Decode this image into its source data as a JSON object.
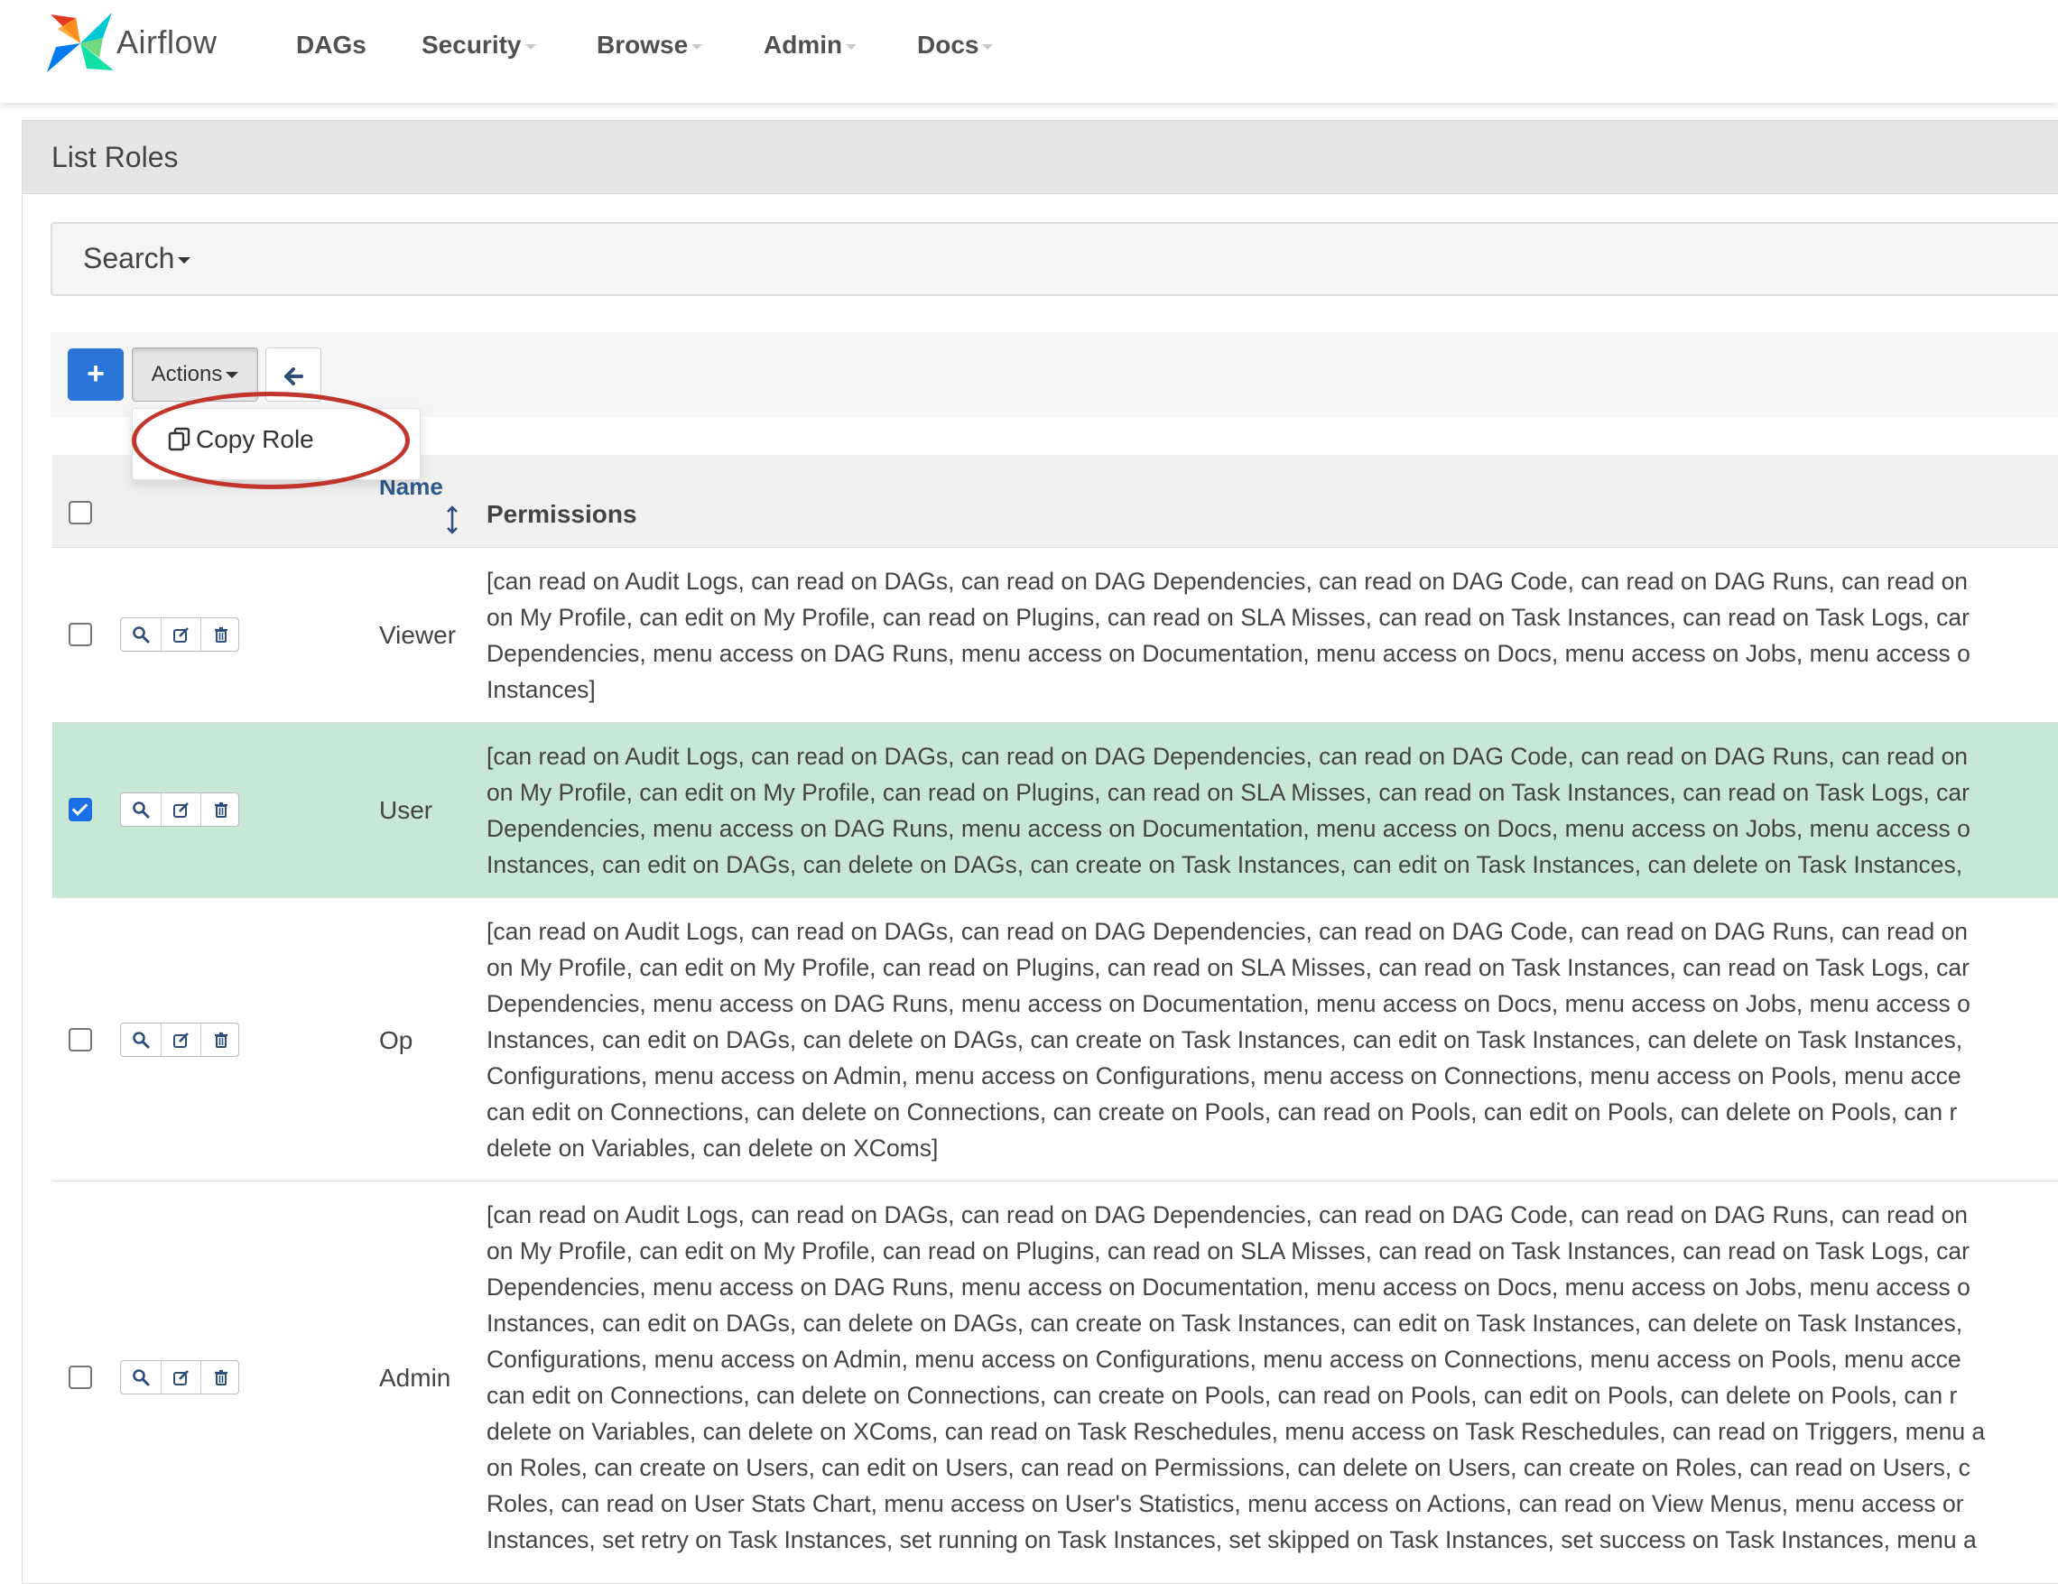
{
  "navbar": {
    "brand": "Airflow",
    "items": [
      {
        "label": "DAGs",
        "dropdown": false
      },
      {
        "label": "Security",
        "dropdown": true
      },
      {
        "label": "Browse",
        "dropdown": true
      },
      {
        "label": "Admin",
        "dropdown": true
      },
      {
        "label": "Docs",
        "dropdown": true
      }
    ]
  },
  "panel": {
    "title": "List Roles"
  },
  "search": {
    "label": "Search"
  },
  "toolbar": {
    "add_label": "+",
    "actions_label": "Actions",
    "actions_menu": [
      {
        "label": "Copy Role",
        "icon": "copy-icon"
      }
    ]
  },
  "annotation": {
    "color": "#c0362c",
    "target": "Copy Role"
  },
  "table": {
    "columns": {
      "name": "Name",
      "permissions": "Permissions"
    },
    "rows": [
      {
        "name": "Viewer",
        "selected": false,
        "permission_lines": [
          "[can read on Audit Logs, can read on DAGs, can read on DAG Dependencies, can read on DAG Code, can read on DAG Runs, can read on",
          "on My Profile, can edit on My Profile, can read on Plugins, can read on SLA Misses, can read on Task Instances, can read on Task Logs, car",
          "Dependencies, menu access on DAG Runs, menu access on Documentation, menu access on Docs, menu access on Jobs, menu access o",
          "Instances]"
        ]
      },
      {
        "name": "User",
        "selected": true,
        "permission_lines": [
          "[can read on Audit Logs, can read on DAGs, can read on DAG Dependencies, can read on DAG Code, can read on DAG Runs, can read on",
          "on My Profile, can edit on My Profile, can read on Plugins, can read on SLA Misses, can read on Task Instances, can read on Task Logs, car",
          "Dependencies, menu access on DAG Runs, menu access on Documentation, menu access on Docs, menu access on Jobs, menu access o",
          "Instances, can edit on DAGs, can delete on DAGs, can create on Task Instances, can edit on Task Instances, can delete on Task Instances,"
        ]
      },
      {
        "name": "Op",
        "selected": false,
        "permission_lines": [
          "[can read on Audit Logs, can read on DAGs, can read on DAG Dependencies, can read on DAG Code, can read on DAG Runs, can read on",
          "on My Profile, can edit on My Profile, can read on Plugins, can read on SLA Misses, can read on Task Instances, can read on Task Logs, car",
          "Dependencies, menu access on DAG Runs, menu access on Documentation, menu access on Docs, menu access on Jobs, menu access o",
          "Instances, can edit on DAGs, can delete on DAGs, can create on Task Instances, can edit on Task Instances, can delete on Task Instances,",
          "Configurations, menu access on Admin, menu access on Configurations, menu access on Connections, menu access on Pools, menu acce",
          "can edit on Connections, can delete on Connections, can create on Pools, can read on Pools, can edit on Pools, can delete on Pools, can r",
          "delete on Variables, can delete on XComs]"
        ]
      },
      {
        "name": "Admin",
        "selected": false,
        "permission_lines": [
          "[can read on Audit Logs, can read on DAGs, can read on DAG Dependencies, can read on DAG Code, can read on DAG Runs, can read on",
          "on My Profile, can edit on My Profile, can read on Plugins, can read on SLA Misses, can read on Task Instances, can read on Task Logs, car",
          "Dependencies, menu access on DAG Runs, menu access on Documentation, menu access on Docs, menu access on Jobs, menu access o",
          "Instances, can edit on DAGs, can delete on DAGs, can create on Task Instances, can edit on Task Instances, can delete on Task Instances,",
          "Configurations, menu access on Admin, menu access on Configurations, menu access on Connections, menu access on Pools, menu acce",
          "can edit on Connections, can delete on Connections, can create on Pools, can read on Pools, can edit on Pools, can delete on Pools, can r",
          "delete on Variables, can delete on XComs, can read on Task Reschedules, menu access on Task Reschedules, can read on Triggers, menu a",
          "on Roles, can create on Users, can edit on Users, can read on Permissions, can delete on Users, can create on Roles, can read on Users, c",
          "Roles, can read on User Stats Chart, menu access on User's Statistics, menu access on Actions, can read on View Menus, menu access or",
          "Instances, set retry on Task Instances, set running on Task Instances, set skipped on Task Instances, set success on Task Instances, menu a"
        ]
      }
    ]
  }
}
